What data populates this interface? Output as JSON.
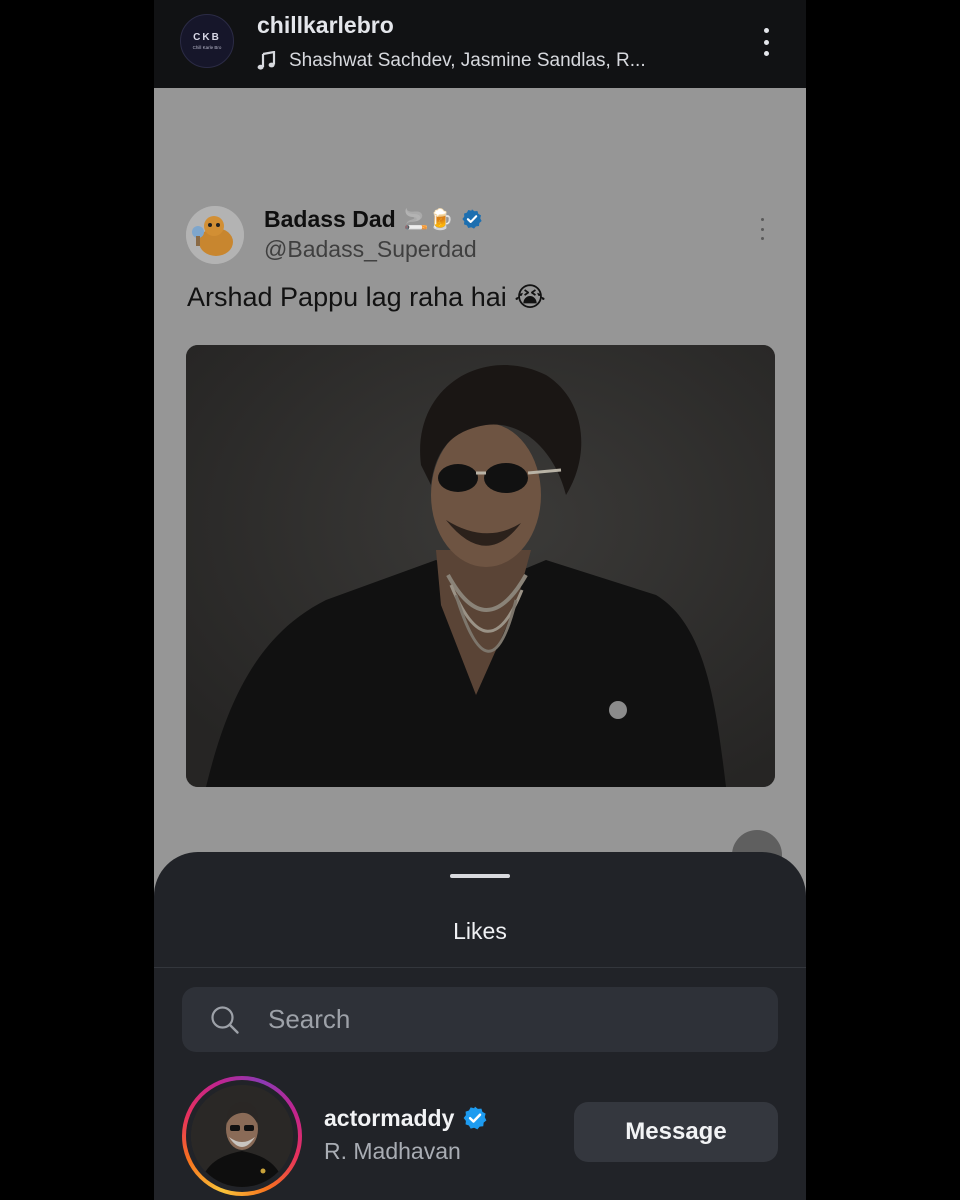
{
  "header": {
    "avatar_text": "CKB",
    "avatar_subtext": "Chill Karle Bro",
    "account_name": "chillkarlebro",
    "music_text": "Shashwat Sachdev, Jasmine Sandlas, R...",
    "icons": {
      "music": "music-note-icon",
      "more": "more-vertical-icon"
    }
  },
  "post": {
    "author_name": "Badass Dad",
    "author_emoji": "🚬🍺",
    "author_handle": "@Badass_Superdad",
    "text": "Arshad Pappu lag raha hai 😭",
    "icons": {
      "verified": "verified-badge-icon",
      "more": "more-vertical-icon",
      "mute": "speaker-muted-icon"
    }
  },
  "likes_sheet": {
    "title": "Likes",
    "search": {
      "placeholder": "Search",
      "value": ""
    },
    "users": [
      {
        "username": "actormaddy",
        "full_name": "R. Madhavan",
        "verified": true,
        "action_label": "Message"
      }
    ]
  },
  "colors": {
    "verified_blue": "#1d9bf0",
    "sheet_background": "#212328",
    "dimmed_overlay": "#969696"
  }
}
